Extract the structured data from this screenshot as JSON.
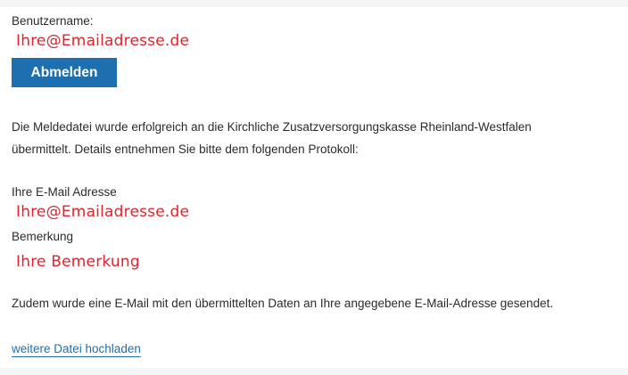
{
  "account": {
    "username_label": "Benutzername:",
    "username_value": "Ihre@Emailadresse.de",
    "logout_label": "Abmelden"
  },
  "result": {
    "message_line1": "Die Meldedatei wurde erfolgreich an die Kirchliche Zusatzversorgungskasse Rheinland-Westfalen",
    "message_line2": "übermittelt. Details entnehmen Sie bitte dem folgenden Protokoll:"
  },
  "protocol": {
    "email_label": "Ihre E-Mail Adresse",
    "email_value": "Ihre@Emailadresse.de",
    "remark_label": "Bemerkung",
    "remark_value": "Ihre Bemerkung"
  },
  "footer": {
    "confirmation_text": "Zudem wurde eine E-Mail mit den übermittelten Daten an Ihre angegebene E-Mail-Adresse gesendet.",
    "upload_link_label": "weitere Datei hochladen"
  },
  "colors": {
    "accent_blue": "#1e6fb0",
    "highlight_red": "#e0242d"
  }
}
